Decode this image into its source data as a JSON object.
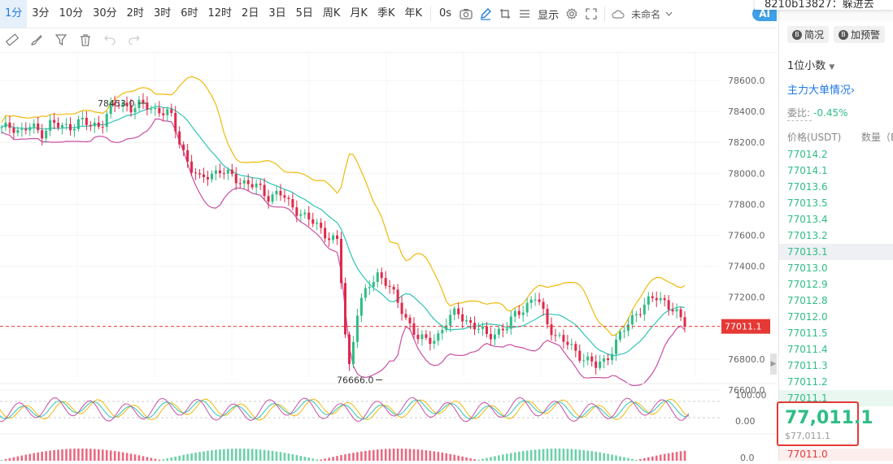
{
  "toolbar": {
    "timeframes": [
      "1分",
      "3分",
      "10分",
      "30分",
      "2时",
      "3时",
      "6时",
      "12时",
      "2日",
      "3日",
      "5日",
      "周K",
      "月K",
      "季K",
      "年K"
    ],
    "active_timeframe": "1分",
    "countdown": "0s",
    "show_label": "显示",
    "cloud_name": "未命名",
    "ai_label": "AI"
  },
  "tooltip_text": "8210b13827：躲进去",
  "chart": {
    "y_ticks": [
      "78600.0",
      "78400.0",
      "78200.0",
      "78000.0",
      "77800.0",
      "77600.0",
      "77400.0",
      "77200.0",
      "77000.0",
      "76800.0",
      "76600.0"
    ],
    "y_values": [
      78600,
      78400,
      78200,
      78000,
      77800,
      77600,
      77400,
      77200,
      77000,
      76800,
      76600
    ],
    "current_price_label": "77011.1",
    "current_price": 77011.1,
    "high_annotation": "78453.0",
    "low_annotation": "76666.0",
    "osc_ticks": [
      "100.00",
      "0.00"
    ],
    "macd_tick": "0.0",
    "colors": {
      "up": "#2ebd85",
      "down": "#e0294a",
      "boll_upper": "#f0b90b",
      "boll_mid": "#2ec4b6",
      "boll_lower": "#c74fa3",
      "price_line": "#e53935"
    }
  },
  "chart_data": {
    "type": "candlestick",
    "ylim": [
      76500,
      78700
    ],
    "current_price": 77011.1,
    "high": 78453.0,
    "low": 76666.0,
    "price_path_close": [
      78280,
      78310,
      78270,
      78300,
      78260,
      78330,
      78290,
      78310,
      78340,
      78300,
      78320,
      78420,
      78450,
      78430,
      78440,
      78420,
      78410,
      78380,
      78200,
      78050,
      77950,
      78000,
      78020,
      77980,
      77960,
      77930,
      77900,
      77850,
      77880,
      77800,
      77760,
      77700,
      77650,
      77600,
      77550,
      76700,
      77150,
      77250,
      77350,
      77300,
      77150,
      77050,
      76950,
      76900,
      76950,
      77050,
      77100,
      77050,
      77000,
      76950,
      76980,
      77000,
      77100,
      77150,
      77200,
      77050,
      76950,
      76900,
      76850,
      76800,
      76750,
      76800,
      76900,
      77000,
      77100,
      77150,
      77200,
      77180,
      77100,
      77011.1
    ]
  },
  "right_panel": {
    "tab_brief": "简况",
    "tab_warn": "加预警",
    "decimal": "1位小数",
    "big_orders": "主力大单情况",
    "ratio_label": "委比:",
    "ratio_value": "-0.45%",
    "col_price": "价格(USDT)",
    "col_qty": "数量（B",
    "asks": [
      "77014.2",
      "77014.1",
      "77013.6",
      "77013.5",
      "77013.4",
      "77013.2",
      "77013.1",
      "77013.0",
      "77012.9",
      "77012.8",
      "77012.0",
      "77011.5",
      "77011.4",
      "77011.3",
      "77011.2",
      "77011.1"
    ],
    "last_price": "77,011.1",
    "last_usd": "$77,011.1",
    "bid_first": "77011.0"
  }
}
